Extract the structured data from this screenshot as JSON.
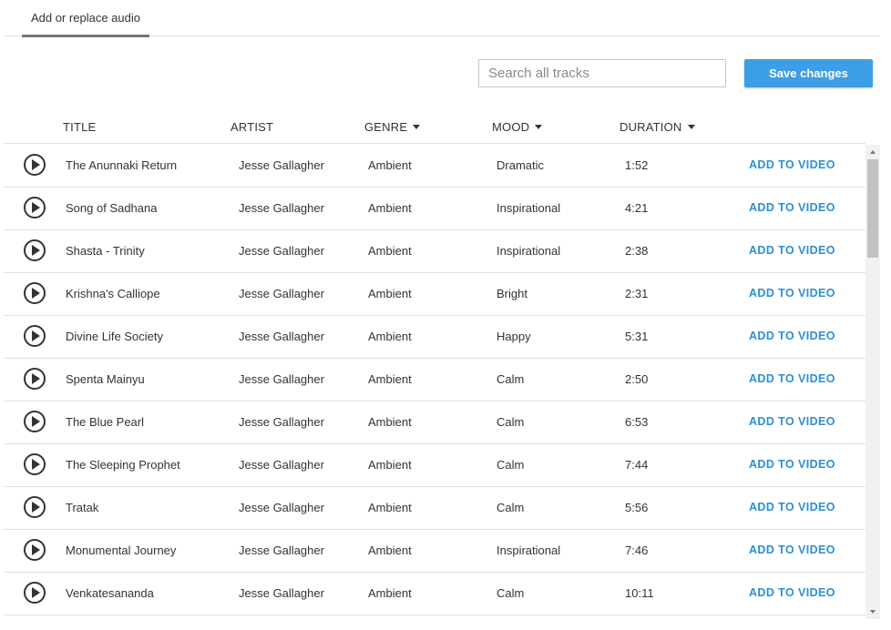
{
  "tabs": {
    "active_label": "Add or replace audio"
  },
  "toolbar": {
    "search_placeholder": "Search all tracks",
    "save_label": "Save changes"
  },
  "columns": {
    "title": "TITLE",
    "artist": "ARTIST",
    "genre": "GENRE",
    "mood": "MOOD",
    "duration": "DURATION"
  },
  "tracks": [
    {
      "title": "The Anunnaki Return",
      "artist": "Jesse Gallagher",
      "genre": "Ambient",
      "mood": "Dramatic",
      "duration": "1:52",
      "action": "ADD TO VIDEO"
    },
    {
      "title": "Song of Sadhana",
      "artist": "Jesse Gallagher",
      "genre": "Ambient",
      "mood": "Inspirational",
      "duration": "4:21",
      "action": "ADD TO VIDEO"
    },
    {
      "title": "Shasta - Trinity",
      "artist": "Jesse Gallagher",
      "genre": "Ambient",
      "mood": "Inspirational",
      "duration": "2:38",
      "action": "ADD TO VIDEO"
    },
    {
      "title": "Krishna's Calliope",
      "artist": "Jesse Gallagher",
      "genre": "Ambient",
      "mood": "Bright",
      "duration": "2:31",
      "action": "ADD TO VIDEO"
    },
    {
      "title": "Divine Life Society",
      "artist": "Jesse Gallagher",
      "genre": "Ambient",
      "mood": "Happy",
      "duration": "5:31",
      "action": "ADD TO VIDEO"
    },
    {
      "title": "Spenta Mainyu",
      "artist": "Jesse Gallagher",
      "genre": "Ambient",
      "mood": "Calm",
      "duration": "2:50",
      "action": "ADD TO VIDEO"
    },
    {
      "title": "The Blue Pearl",
      "artist": "Jesse Gallagher",
      "genre": "Ambient",
      "mood": "Calm",
      "duration": "6:53",
      "action": "ADD TO VIDEO"
    },
    {
      "title": "The Sleeping Prophet",
      "artist": "Jesse Gallagher",
      "genre": "Ambient",
      "mood": "Calm",
      "duration": "7:44",
      "action": "ADD TO VIDEO"
    },
    {
      "title": "Tratak",
      "artist": "Jesse Gallagher",
      "genre": "Ambient",
      "mood": "Calm",
      "duration": "5:56",
      "action": "ADD TO VIDEO"
    },
    {
      "title": "Monumental Journey",
      "artist": "Jesse Gallagher",
      "genre": "Ambient",
      "mood": "Inspirational",
      "duration": "7:46",
      "action": "ADD TO VIDEO"
    },
    {
      "title": "Venkatesananda",
      "artist": "Jesse Gallagher",
      "genre": "Ambient",
      "mood": "Calm",
      "duration": "10:11",
      "action": "ADD TO VIDEO"
    }
  ],
  "icons": {
    "play": "play-icon",
    "sort": "caret-down-icon"
  },
  "colors": {
    "accent": "#3d9ee5",
    "link": "#2b8fd6",
    "tab_underline": "#767676"
  }
}
